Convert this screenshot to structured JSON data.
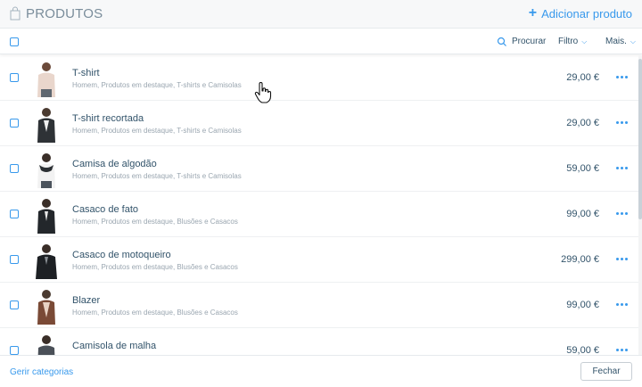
{
  "header": {
    "title": "PRODUTOS",
    "add_label": "Adicionar produto",
    "add_icon": "plus-icon",
    "bag_icon": "shopping-bag-icon"
  },
  "toolbar": {
    "search_label": "Procurar",
    "filter_label": "Filtro",
    "more_label": "Mais."
  },
  "products": [
    {
      "name": "T-shirt",
      "categories": "Homem, Produtos em destaque, T-shirts e Camisolas",
      "price": "29,00 €",
      "thumb": "person-in-shirt"
    },
    {
      "name": "T-shirt recortada",
      "categories": "Homem, Produtos em destaque, T-shirts e Camisolas",
      "price": "29,00 €",
      "thumb": "person-in-jacket"
    },
    {
      "name": "Camisa de algodão",
      "categories": "Homem, Produtos em destaque, T-shirts e Camisolas",
      "price": "59,00 €",
      "thumb": "person-with-scarf"
    },
    {
      "name": "Casaco de fato",
      "categories": "Homem, Produtos em destaque, Blusões e Casacos",
      "price": "99,00 €",
      "thumb": "person-in-suit"
    },
    {
      "name": "Casaco de motoqueiro",
      "categories": "Homem, Produtos em destaque, Blusões e Casacos",
      "price": "299,00 €",
      "thumb": "person-in-leather-jacket"
    },
    {
      "name": "Blazer",
      "categories": "Homem, Produtos em destaque, Blusões e Casacos",
      "price": "99,00 €",
      "thumb": "person-in-blazer"
    },
    {
      "name": "Camisola de malha",
      "categories": "",
      "price": "59,00 €",
      "thumb": "person-in-sweater"
    }
  ],
  "footer": {
    "manage_label": "Gerir categorias",
    "close_label": "Fechar"
  },
  "colors": {
    "accent": "#3899ec",
    "text": "#32536a",
    "muted": "#9aa6b0"
  }
}
